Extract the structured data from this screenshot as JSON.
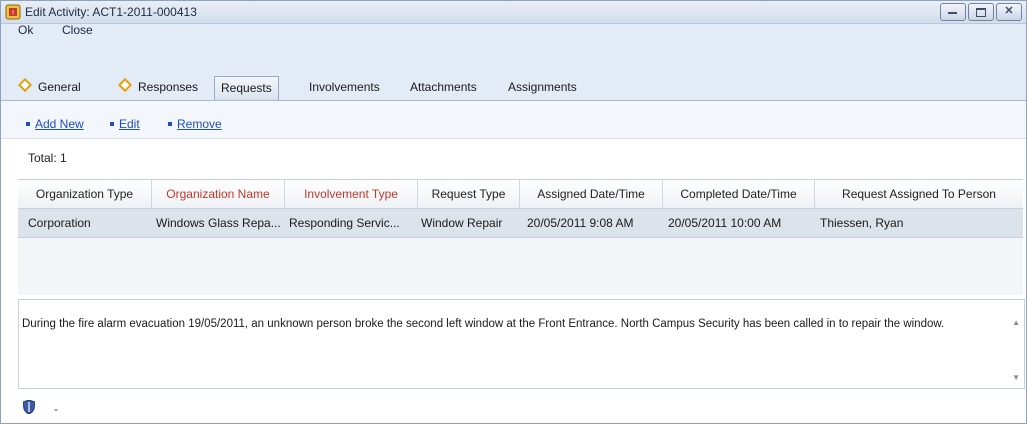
{
  "window": {
    "title": "Edit Activity: ACT1-2011-000413"
  },
  "menu": {
    "ok": "Ok",
    "close": "Close"
  },
  "tabs": [
    {
      "label": "General"
    },
    {
      "label": "Responses"
    },
    {
      "label": "Requests"
    },
    {
      "label": "Involvements"
    },
    {
      "label": "Attachments"
    },
    {
      "label": "Assignments"
    }
  ],
  "actions": {
    "add_new": "Add New",
    "edit": "Edit",
    "remove": "Remove"
  },
  "total": "Total: 1",
  "table": {
    "columns": [
      "Organization Type",
      "Organization Name",
      "Involvement Type",
      "Request Type",
      "Assigned Date/Time",
      "Completed Date/Time",
      "Request Assigned To Person"
    ],
    "rows": [
      {
        "organization_type": "Corporation",
        "organization_name": "Windows Glass Repa...",
        "involvement_type": "Responding Servic...",
        "request_type": "Window Repair",
        "assigned": "20/05/2011  9:08 AM",
        "completed": "20/05/2011  10:00 AM",
        "person": "Thiessen, Ryan"
      }
    ]
  },
  "description": "During the fire alarm evacuation 19/05/2011, an unknown person broke the second left window at the Front Entrance. North Campus Security has been called in to repair the window.",
  "footer": {
    "text": "-"
  },
  "colors": {
    "required_header": "#c0392b",
    "link": "#1f4fbf",
    "tab_marker": "#e0a010"
  }
}
